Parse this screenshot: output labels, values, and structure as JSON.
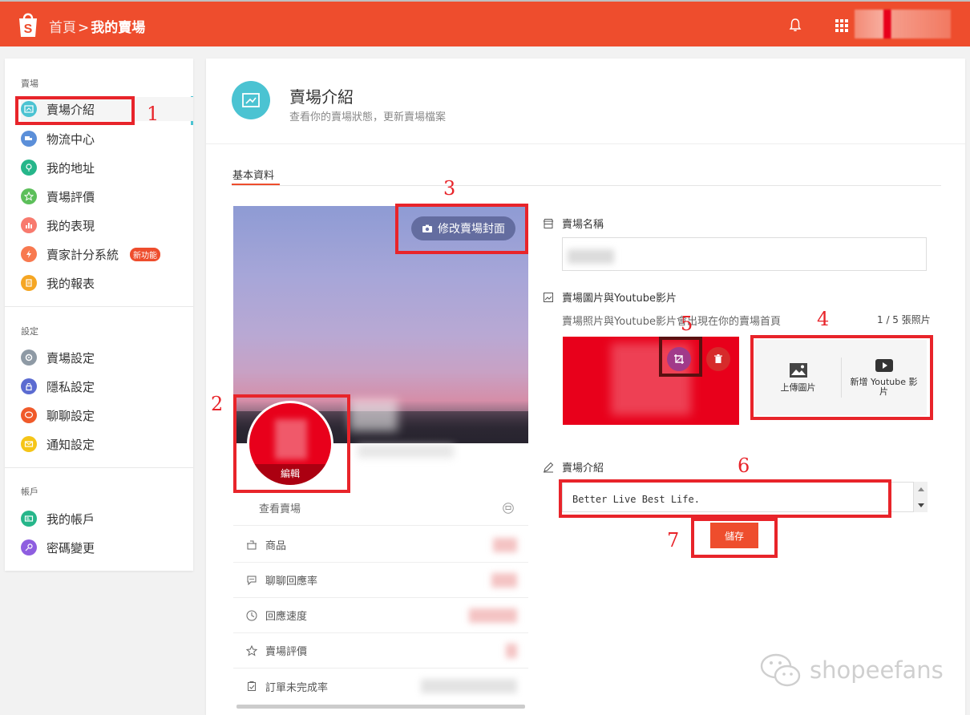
{
  "header": {
    "breadcrumb_home": "首頁",
    "breadcrumb_sep": ">",
    "breadcrumb_current": "我的賣場",
    "brand_color": "#ee4d2d"
  },
  "sidebar": {
    "sections": [
      {
        "title": "賣場",
        "items": [
          {
            "label": "賣場介紹",
            "icon": "shop-intro-icon",
            "color": "#4bc3d2"
          },
          {
            "label": "物流中心",
            "icon": "truck-icon",
            "color": "#5b8fd9"
          },
          {
            "label": "我的地址",
            "icon": "location-icon",
            "color": "#26b68a"
          },
          {
            "label": "賣場評價",
            "icon": "star-icon",
            "color": "#5cbf5a"
          },
          {
            "label": "我的表現",
            "icon": "chart-icon",
            "color": "#f87a6e"
          },
          {
            "label": "賣家計分系統",
            "icon": "lightning-icon",
            "color": "#f8794f",
            "badge": "新功能"
          },
          {
            "label": "我的報表",
            "icon": "report-icon",
            "color": "#f5a623"
          }
        ]
      },
      {
        "title": "設定",
        "items": [
          {
            "label": "賣場設定",
            "icon": "gear-icon",
            "color": "#8e9aa5"
          },
          {
            "label": "隱私設定",
            "icon": "lock-icon",
            "color": "#5b6bd1"
          },
          {
            "label": "聊聊設定",
            "icon": "chat-icon",
            "color": "#f05a2a"
          },
          {
            "label": "通知設定",
            "icon": "mail-icon",
            "color": "#f5c518"
          }
        ]
      },
      {
        "title": "帳戶",
        "items": [
          {
            "label": "我的帳戶",
            "icon": "id-card-icon",
            "color": "#26b68a"
          },
          {
            "label": "密碼變更",
            "icon": "key-icon",
            "color": "#8e5ee0"
          }
        ]
      }
    ]
  },
  "annotations": [
    "1",
    "2",
    "3",
    "4",
    "5",
    "6",
    "7"
  ],
  "main": {
    "title": "賣場介紹",
    "subtitle": "查看你的賣場狀態，更新賣場檔案",
    "tab": "基本資料",
    "cover_button": "修改賣場封面",
    "avatar_edit": "編輯",
    "stats": {
      "view_shop": "查看賣場",
      "items": [
        "商品",
        "聊聊回應率",
        "回應速度",
        "賣場評價",
        "訂單未完成率"
      ]
    },
    "form": {
      "shop_name_label": "賣場名稱",
      "media_label": "賣場圖片與Youtube影片",
      "media_hint": "賣場照片與Youtube影片會出現在你的賣場首頁",
      "photo_count": "1 / 5 張照片",
      "upload_image": "上傳圖片",
      "add_youtube": "新增 Youtube 影片",
      "description_label": "賣場介紹",
      "description_value": "Better Live Best Life.",
      "save_button": "儲存"
    }
  },
  "watermark": "shopeefans"
}
